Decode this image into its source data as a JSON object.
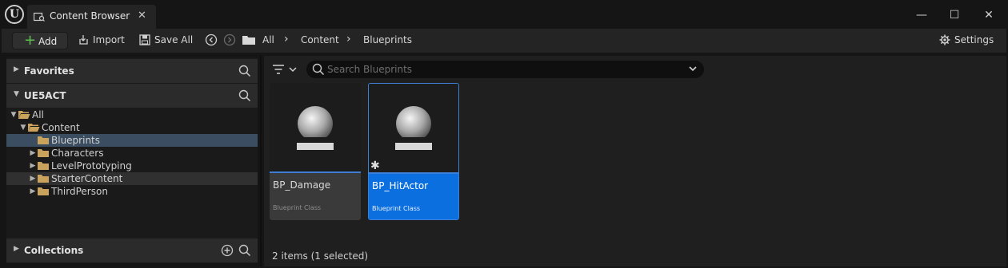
{
  "window": {
    "tab_label": "Content Browser",
    "tab_close": "✕",
    "minimize": "—",
    "maximize": "☐",
    "close": "✕"
  },
  "toolbar": {
    "add_label": "Add",
    "import_label": "Import",
    "save_all_label": "Save All",
    "breadcrumbs": [
      "All",
      "Content",
      "Blueprints"
    ],
    "settings_label": "Settings"
  },
  "favorites": {
    "title": "Favorites"
  },
  "project": {
    "title": "UE5ACT",
    "tree": [
      {
        "label": "All",
        "level": 0,
        "expanded": true,
        "state": "normal"
      },
      {
        "label": "Content",
        "level": 1,
        "expanded": true,
        "state": "normal"
      },
      {
        "label": "Blueprints",
        "level": 2,
        "expanded": false,
        "leaf": true,
        "state": "selected"
      },
      {
        "label": "Characters",
        "level": 2,
        "expanded": false,
        "state": "normal"
      },
      {
        "label": "LevelPrototyping",
        "level": 2,
        "expanded": false,
        "state": "normal"
      },
      {
        "label": "StarterContent",
        "level": 2,
        "expanded": false,
        "state": "hover"
      },
      {
        "label": "ThirdPerson",
        "level": 2,
        "expanded": false,
        "state": "normal"
      }
    ]
  },
  "collections": {
    "title": "Collections"
  },
  "search": {
    "placeholder": "Search Blueprints",
    "value": ""
  },
  "assets": [
    {
      "name": "BP_Damage",
      "type": "Blueprint Class",
      "selected": false,
      "modified": false
    },
    {
      "name": "BP_HitActor",
      "type": "Blueprint Class",
      "selected": true,
      "modified": true
    }
  ],
  "status": "2 items (1 selected)",
  "colors": {
    "accent": "#0b6fe0",
    "selection_tree": "#3b4d61",
    "folder": "#c9a35c",
    "add_plus": "#5fc04f"
  }
}
